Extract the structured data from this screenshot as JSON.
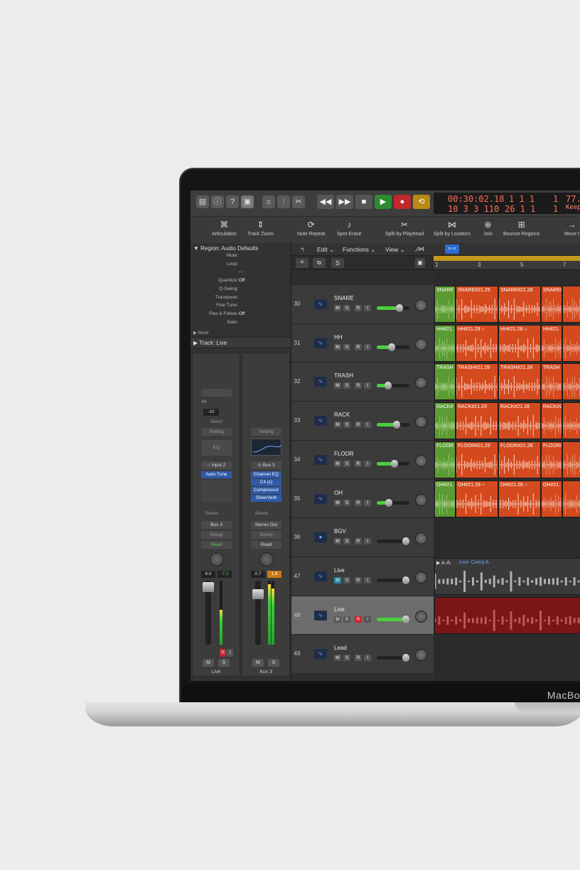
{
  "brand": "MacBo",
  "transport": {
    "time": "00:30:02.18",
    "bars": "10 3 3 110",
    "pos_top": "1 1 1",
    "pos_bot": "26 1 1",
    "pos_top_tail": "1",
    "pos_bot_tail": "1",
    "tempo": "77.",
    "keep": "Keep"
  },
  "toolbar": {
    "items": [
      {
        "label": "Articulation",
        "icon": "⌘"
      },
      {
        "label": "Track Zoom",
        "icon": "⇕"
      },
      {
        "label": "Note Repeat",
        "icon": "⟳"
      },
      {
        "label": "Spot Erase",
        "icon": "♪"
      },
      {
        "label": "Split by Playhead",
        "icon": "✂"
      },
      {
        "label": "Split by Locators",
        "icon": "⋈"
      },
      {
        "label": "Join",
        "icon": "⊕"
      },
      {
        "label": "Bounce Regions",
        "icon": "⊞"
      },
      {
        "label": "Move t",
        "icon": "→"
      }
    ]
  },
  "inspector": {
    "region_title": "Region: Audio Defaults",
    "params": [
      {
        "k": "Mute:",
        "v": ""
      },
      {
        "k": "Loop:",
        "v": ""
      },
      {
        "k": "",
        "v": "-  -"
      },
      {
        "k": "Quantize:",
        "v": "Off"
      },
      {
        "k": "Q-Swing:",
        "v": ""
      },
      {
        "k": "Transpose:",
        "v": ""
      },
      {
        "k": "Fine Tune:",
        "v": ""
      },
      {
        "k": "Flex & Follow:",
        "v": "Off"
      },
      {
        "k": "Gain:",
        "v": ""
      }
    ],
    "more": "More",
    "track_title": "Track:  Live",
    "strips": [
      {
        "gain": "48",
        "trim": "-10",
        "direct": "Direct",
        "setting": "Setting",
        "eq": "EQ",
        "input": "Input 2",
        "plugins": [
          "Auto-Tune"
        ],
        "sends": "Sends",
        "output": "Bus 3",
        "group": "Group",
        "auto": "Read",
        "vol": "6.0",
        "peak": "-7.2",
        "name": "Live",
        "meter_level": 0.55
      },
      {
        "setting": "Setting",
        "input": "Bus 3",
        "plugins": [
          "Channel EQ",
          "C4 (s)",
          "Compressor",
          "SilverVerb"
        ],
        "sends": "Sends",
        "output": "Stereo Out",
        "group": "Group",
        "auto": "Read",
        "vol": "0.7",
        "peak": "1.9",
        "name": "Aux 3",
        "meter_level": 0.95
      }
    ],
    "m": "M",
    "s": "S",
    "r": "R",
    "i": "I"
  },
  "edit_menu": {
    "edit": "Edit",
    "functions": "Functions",
    "view": "View"
  },
  "track_header": {
    "s": "S"
  },
  "tracks": [
    {
      "num": "30",
      "name": "SNARE",
      "vol": 0.7,
      "rec": false,
      "mute": false
    },
    {
      "num": "31",
      "name": "HH",
      "vol": 0.45,
      "rec": false,
      "mute": false
    },
    {
      "num": "32",
      "name": "TRASH",
      "vol": 0.35,
      "rec": false,
      "mute": false
    },
    {
      "num": "33",
      "name": "RACK",
      "vol": 0.6,
      "rec": false,
      "mute": false
    },
    {
      "num": "34",
      "name": "FLOOR",
      "vol": 0.55,
      "rec": false,
      "mute": false
    },
    {
      "num": "35",
      "name": "OH",
      "vol": 0.38,
      "rec": false,
      "mute": false
    },
    {
      "num": "36",
      "name": "BGV",
      "vol": 0.0,
      "rec": false,
      "mute": false,
      "folder": true
    },
    {
      "num": "47",
      "name": "Live",
      "vol": 0.0,
      "rec": false,
      "mute": true
    },
    {
      "num": "48",
      "name": "Live",
      "vol": 0.95,
      "rec": true,
      "mute": false,
      "selected": true
    },
    {
      "num": "49",
      "name": "Lead",
      "vol": 0.0,
      "rec": false,
      "mute": false
    }
  ],
  "ruler": [
    "1",
    "3",
    "5",
    "7"
  ],
  "regions": [
    [
      "SNARE",
      "SNARE#21.29",
      "SNARE#21.28",
      "SNARE#"
    ],
    [
      "HH#21.",
      "HH#21.29  ○",
      "HH#21.28  ○",
      "HH#21."
    ],
    [
      "TRASH",
      "TRASH#21.29",
      "TRASH#21.28",
      "TRASH"
    ],
    [
      "RACK#",
      "RACK#21.29",
      "RACK#21.28",
      "RACK#2"
    ],
    [
      "FLOOR",
      "FLOOR#21.29",
      "FLOOR#21.28",
      "FLOOR#"
    ],
    [
      "OH#21.",
      "OH#21.29  ○",
      "OH#21.28  ○",
      "OH#21."
    ]
  ],
  "comp_label": "Live: Comp A",
  "comp_prefix": "▶ A ⁂"
}
